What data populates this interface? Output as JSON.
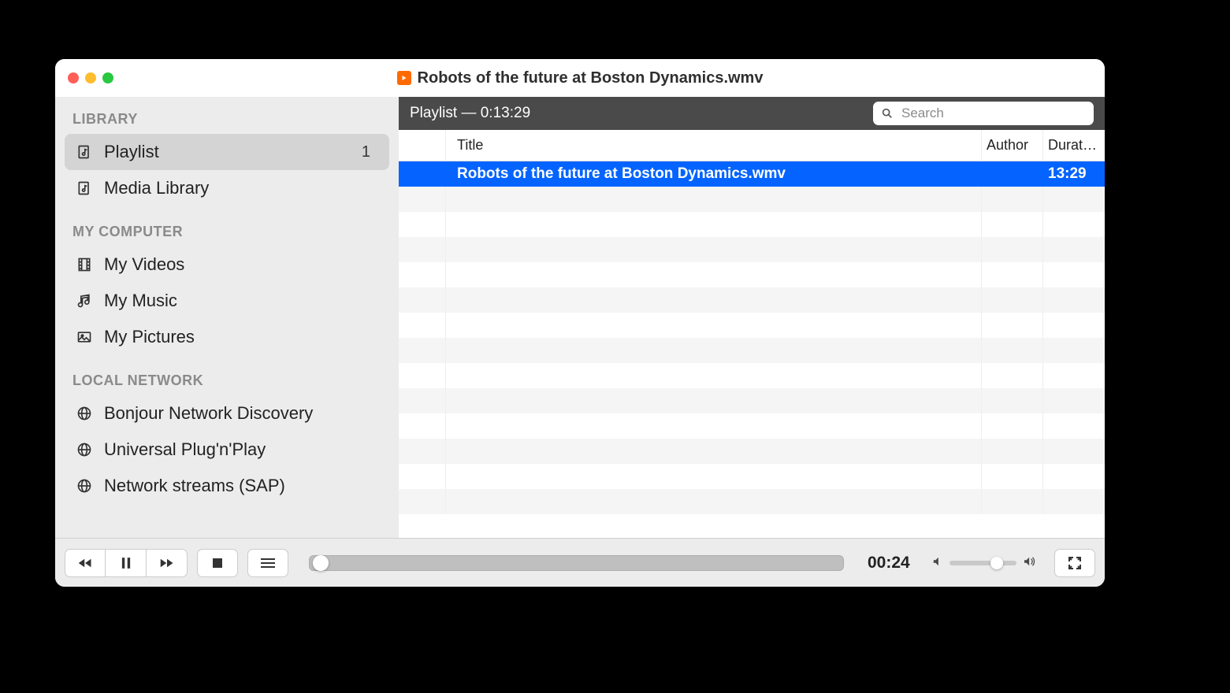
{
  "window": {
    "title": "Robots of the future at Boston Dynamics.wmv"
  },
  "sidebar": {
    "sections": {
      "library": {
        "label": "LIBRARY"
      },
      "computer": {
        "label": "MY COMPUTER"
      },
      "network": {
        "label": "LOCAL NETWORK"
      }
    },
    "library_items": [
      {
        "label": "Playlist",
        "count": "1",
        "selected": true,
        "icon": "playlist"
      },
      {
        "label": "Media Library",
        "icon": "playlist"
      }
    ],
    "computer_items": [
      {
        "label": "My Videos",
        "icon": "film"
      },
      {
        "label": "My Music",
        "icon": "music"
      },
      {
        "label": "My Pictures",
        "icon": "picture"
      }
    ],
    "network_items": [
      {
        "label": "Bonjour Network Discovery",
        "icon": "globe"
      },
      {
        "label": "Universal Plug'n'Play",
        "icon": "globe"
      },
      {
        "label": "Network streams (SAP)",
        "icon": "globe"
      }
    ]
  },
  "playlist": {
    "header": "Playlist — 0:13:29",
    "search_placeholder": "Search",
    "columns": {
      "title": "Title",
      "author": "Author",
      "duration": "Durat…"
    },
    "rows": [
      {
        "title": "Robots of the future at Boston Dynamics.wmv",
        "author": "",
        "duration": "13:29",
        "selected": true
      }
    ]
  },
  "controls": {
    "elapsed": "00:24"
  }
}
